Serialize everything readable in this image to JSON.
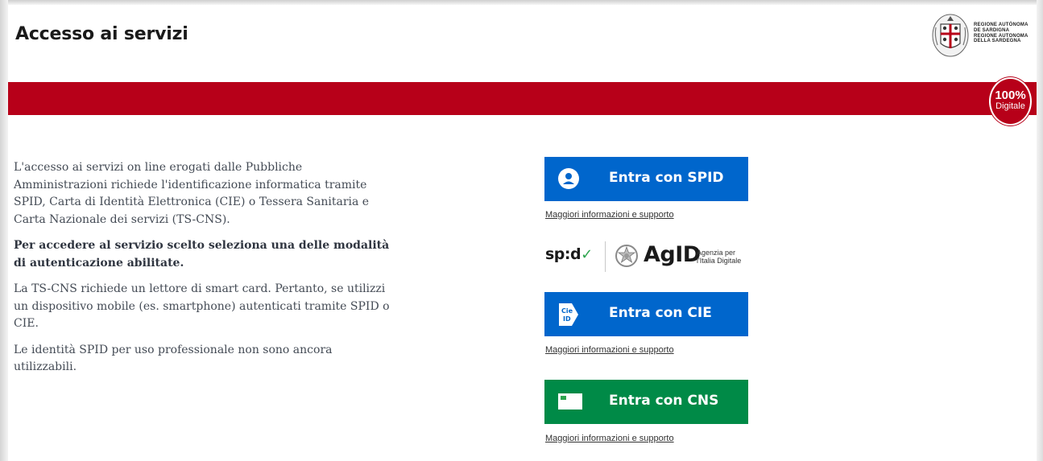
{
  "header": {
    "title": "Accesso ai servizi",
    "region_name_sardinian": "REGIONE AUTÒNOMA DE SARDIGNA",
    "region_name_italian": "REGIONE AUTONOMA DELLA SARDEGNA",
    "region_name_sardinian_line1": "REGIONE AUTÒNOMA",
    "region_name_sardinian_line2": "DE SARDIGNA",
    "region_name_italian_line1": "REGIONE AUTONOMA",
    "region_name_italian_line2": "DELLA SARDEGNA"
  },
  "badge": {
    "percent": "100%",
    "label": "Digitale"
  },
  "info": {
    "paragraph_1": "L'accesso ai servizi on line erogati dalle Pubbliche Amministrazioni richiede l'identificazione informatica tramite SPID, Carta di Identità Elettronica (CIE) o Tessera Sanitaria e Carta Nazionale dei servizi (TS-CNS).",
    "paragraph_2": "Per accedere al servizio scelto seleziona una delle modalità di autenticazione abilitate.",
    "paragraph_3": "La TS-CNS richiede un lettore di smart card. Pertanto, se utilizzi un dispositivo mobile (es. smartphone) autenticati tramite SPID o CIE.",
    "paragraph_4": "Le identità SPID per uso professionale non sono ancora utilizzabili."
  },
  "login": {
    "spid_label": "Entra con SPID",
    "cie_label": "Entra con CIE",
    "cns_label": "Entra con CNS",
    "help_link": "Maggiori informazioni e supporto",
    "cie_icon_text_1": "Cie",
    "cie_icon_text_2": "ID"
  },
  "logos": {
    "spid_text": "sp:d",
    "spid_check": "✓",
    "agid_text": "AgID",
    "agid_sub_line1": "Agenzia per",
    "agid_sub_line2": "l'Italia Digitale"
  },
  "colors": {
    "brand_red": "#b70019",
    "spid_blue": "#0066cc",
    "cns_green": "#008a47"
  },
  "icons": {
    "spid_button": "user-icon",
    "cie_button": "cie-id-icon",
    "cns_button": "smart-card-icon",
    "region": "sardinia-coat-of-arms",
    "agid": "italian-republic-emblem"
  }
}
